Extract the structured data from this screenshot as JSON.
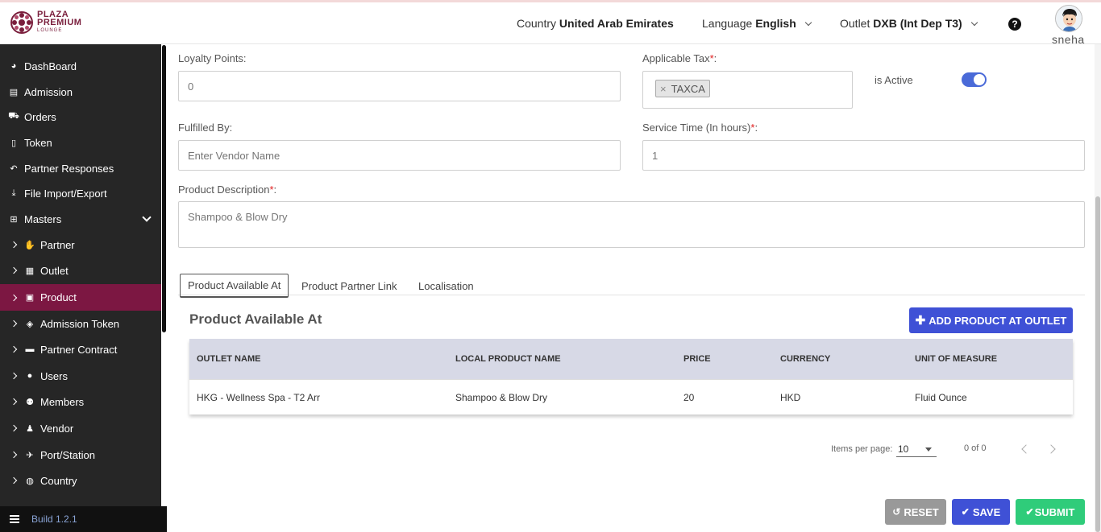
{
  "brand": {
    "line1": "PLAZA",
    "line2": "PREMIUM",
    "line3": "LOUNGE"
  },
  "header": {
    "country_label": "Country",
    "country_value": "United Arab Emirates",
    "language_label": "Language",
    "language_value": "English",
    "outlet_label": "Outlet",
    "outlet_value": "DXB (Int Dep T3)",
    "help_icon": "?",
    "username": "sneha"
  },
  "sidebar": {
    "items": [
      {
        "label": "DashBoard",
        "icon": "tachometer-icon"
      },
      {
        "label": "Admission",
        "icon": "id-card-icon"
      },
      {
        "label": "Orders",
        "icon": "cart-icon"
      },
      {
        "label": "Token",
        "icon": "file-icon"
      },
      {
        "label": "Partner Responses",
        "icon": "reply-all-icon"
      },
      {
        "label": "File Import/Export",
        "icon": "download-icon"
      },
      {
        "label": "Masters",
        "icon": "sitemap-icon"
      }
    ],
    "sub_items": [
      {
        "label": "Partner",
        "icon": "handshake-icon"
      },
      {
        "label": "Outlet",
        "icon": "building-icon"
      },
      {
        "label": "Product",
        "icon": "gift-icon"
      },
      {
        "label": "Admission Token",
        "icon": "ticket-icon"
      },
      {
        "label": "Partner Contract",
        "icon": "briefcase-icon"
      },
      {
        "label": "Users",
        "icon": "user-icon"
      },
      {
        "label": "Members",
        "icon": "users-icon"
      },
      {
        "label": "Vendor",
        "icon": "male-icon"
      },
      {
        "label": "Port/Station",
        "icon": "plane-icon"
      },
      {
        "label": "Country",
        "icon": "globe-icon"
      }
    ],
    "active": "Product",
    "build": "Build 1.2.1"
  },
  "form": {
    "loyalty_label": "Loyalty Points:",
    "loyalty_value": "0",
    "tax_label": "Applicable Tax",
    "tax_chip": "TAXCA",
    "tax_chip_remove": "×",
    "active_label": "is Active",
    "active_state": true,
    "fulfilled_label": "Fulfilled By:",
    "fulfilled_placeholder": "Enter Vendor Name",
    "service_label": "Service Time (In hours)",
    "service_value": "1",
    "desc_label": "Product Description",
    "desc_value": "Shampoo & Blow Dry",
    "required_mark": "*",
    "colon": ":"
  },
  "tabs": [
    "Product Available At",
    "Product Partner Link",
    "Localisation"
  ],
  "section": {
    "title": "Product Available At",
    "add_button": "ADD PRODUCT AT OUTLET",
    "columns": [
      "OUTLET NAME",
      "LOCAL PRODUCT NAME",
      "PRICE",
      "CURRENCY",
      "UNIT OF MEASURE"
    ],
    "rows": [
      [
        "HKG - Wellness Spa - T2 Arr",
        "Shampoo & Blow Dry",
        "20",
        "HKD",
        "Fluid Ounce"
      ]
    ]
  },
  "pagination": {
    "items_per_page_label": "Items per page:",
    "items_per_page": "10",
    "range": "0 of 0"
  },
  "actions": {
    "reset": "RESET",
    "save": "SAVE",
    "submit": "SUBMIT"
  },
  "colors": {
    "sidebar_bg": "#262626",
    "active_item": "#7c1742",
    "primary": "#3f51d6",
    "success": "#2fcc7a",
    "reset": "#999999",
    "table_header": "#d7d9e6"
  }
}
